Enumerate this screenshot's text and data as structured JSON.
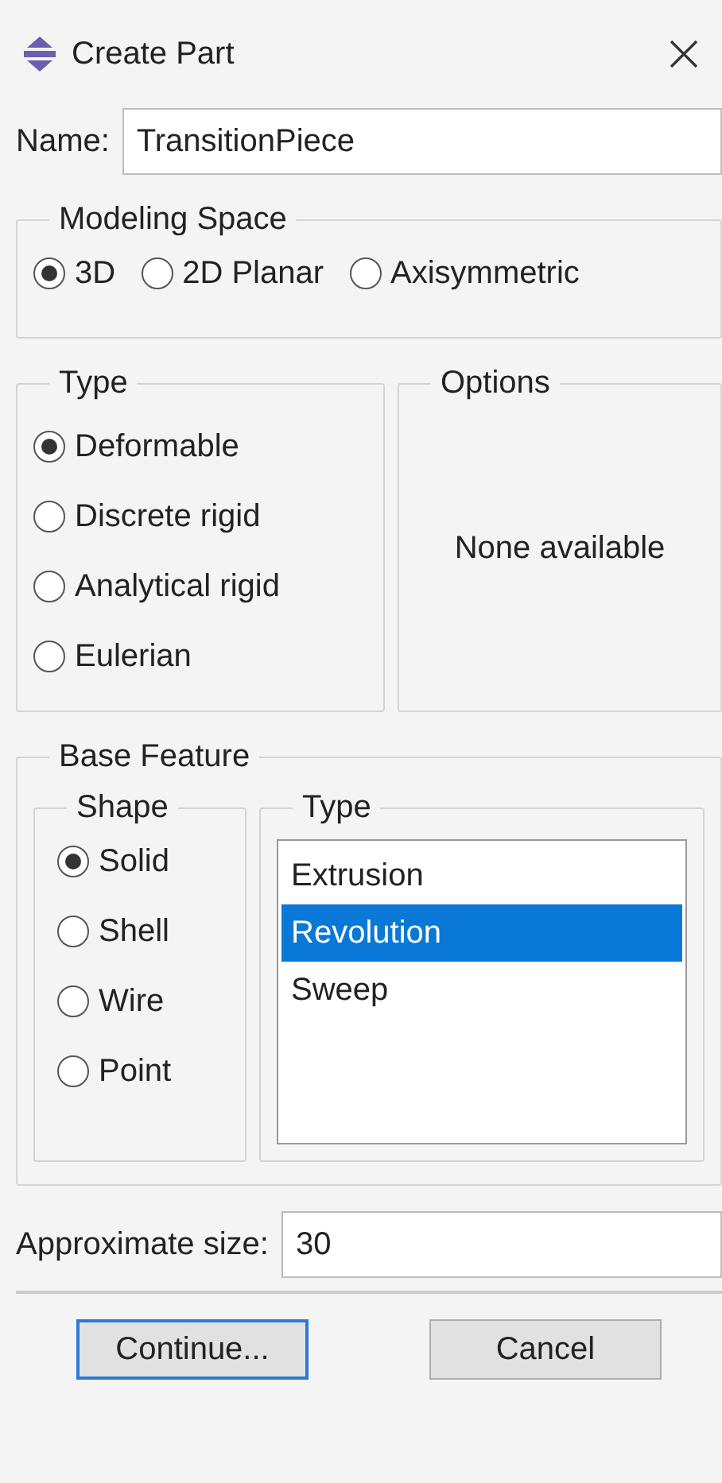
{
  "window": {
    "title": "Create Part"
  },
  "name_field": {
    "label": "Name:",
    "value": "TransitionPiece"
  },
  "modeling_space": {
    "title": "Modeling Space",
    "options": [
      {
        "label": "3D",
        "selected": true
      },
      {
        "label": "2D Planar",
        "selected": false
      },
      {
        "label": "Axisymmetric",
        "selected": false
      }
    ]
  },
  "type": {
    "title": "Type",
    "options": [
      {
        "label": "Deformable",
        "selected": true
      },
      {
        "label": "Discrete rigid",
        "selected": false
      },
      {
        "label": "Analytical rigid",
        "selected": false
      },
      {
        "label": "Eulerian",
        "selected": false
      }
    ]
  },
  "options": {
    "title": "Options",
    "message": "None available"
  },
  "base_feature": {
    "title": "Base Feature",
    "shape": {
      "title": "Shape",
      "options": [
        {
          "label": "Solid",
          "selected": true
        },
        {
          "label": "Shell",
          "selected": false
        },
        {
          "label": "Wire",
          "selected": false
        },
        {
          "label": "Point",
          "selected": false
        }
      ]
    },
    "type": {
      "title": "Type",
      "items": [
        {
          "label": "Extrusion",
          "selected": false
        },
        {
          "label": "Revolution",
          "selected": true
        },
        {
          "label": "Sweep",
          "selected": false
        }
      ]
    }
  },
  "approximate_size": {
    "label": "Approximate size:",
    "value": "30"
  },
  "buttons": [
    {
      "label": "Continue...",
      "default": true
    },
    {
      "label": "Cancel",
      "default": false
    }
  ]
}
